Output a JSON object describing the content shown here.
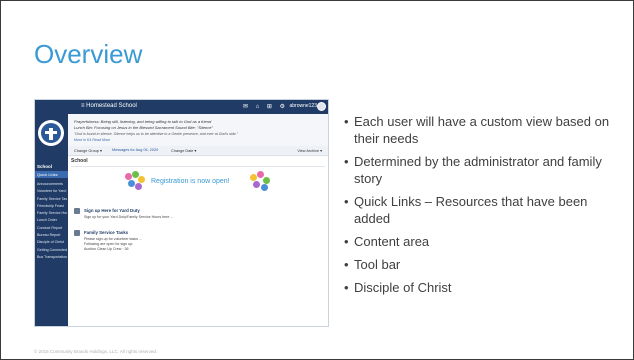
{
  "slide": {
    "title": "Overview",
    "bullets": [
      "Each user will have a custom view based on their needs",
      "Determined by the administrator and family story",
      "Quick Links – Resources that have been added",
      "Content area",
      "Tool bar",
      "Disciple of Christ"
    ],
    "footer": "© 2018 Community Brands Holdings, LLC. All rights reserved."
  },
  "screenshot": {
    "topnav": {
      "brand": "≡    Homestead School",
      "icons": "✉ ⌂ ⊞ ⚙",
      "user": "abrowne123"
    },
    "sidebar": {
      "school": "School",
      "quick_links": "Quick Links",
      "items": [
        "Announcements",
        "Volunteer for Yard Duty",
        "Family Service Tasks",
        "Friendship Feast",
        "Family Service Hours",
        "Lunch Order",
        "Conduct Report",
        "Bureau Report",
        "Disciple of Christ",
        "Getting Connected & Sign-Ups",
        "Bus Transportation Info"
      ]
    },
    "announcement": {
      "line1": "Prayerfulness: Being still, listening, and being willing to talk to God as a friend",
      "line2": "Lunch Bin: Focusing on Jesus in the Blessed Sacrament        Sound Bite: \"Silence\"",
      "line3": "\"God is found in silence. Silence helps us to be attentive to a Gentle presence, and ever at God's side.\"",
      "line4": "More in K4 Read More"
    },
    "toolbar": {
      "change_group": "Change Group  ▾",
      "messages": "Messages for Aug 04, 2020",
      "change_date": "Change Date  ▾",
      "view_archive": "View Archive  ▾"
    },
    "content": {
      "school_heading": "School",
      "registration_text": "Registration is now open!",
      "posts": [
        {
          "title": "Sign up Here for Yard Duty",
          "text": "Sign up for your Yard Duty/Family Service Hours here  ..."
        },
        {
          "title": "Family Service Tasks",
          "text": "Please sign up for volunteer tasks  ...",
          "text2": "Following are open for sign up:",
          "text3": "Auction Clean Up Crew · 36"
        }
      ]
    }
  },
  "colors": {
    "title_blue": "#3a9ad3",
    "nav_navy": "#1f3b66",
    "quick_link_blue": "#3a6ab0"
  }
}
